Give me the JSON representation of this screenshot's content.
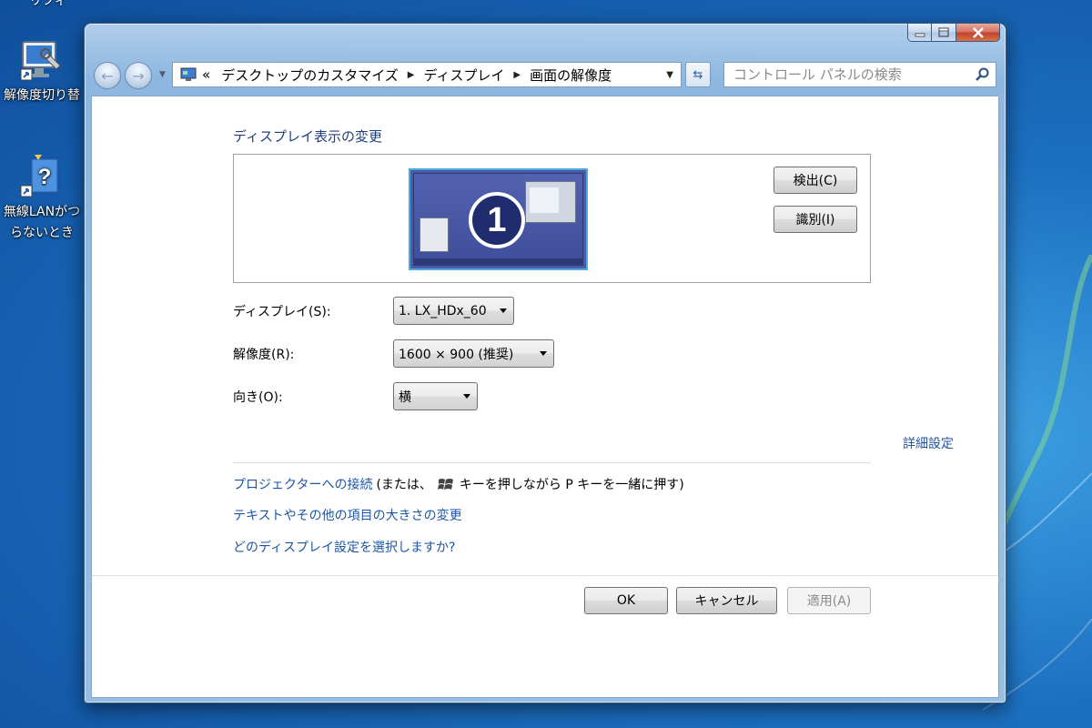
{
  "desktop": {
    "top_cut_label": "リフィ",
    "icons": [
      {
        "label_line1": "解像度切り替",
        "label_line2": ""
      },
      {
        "label_line1": "無線LANがつ",
        "label_line2": "らないとき"
      }
    ]
  },
  "window": {
    "breadcrumb": {
      "prefix": "«",
      "items": [
        "デスクトップのカスタマイズ",
        "ディスプレイ",
        "画面の解像度"
      ]
    },
    "search": {
      "placeholder": "コントロール パネルの検索"
    },
    "section_title": "ディスプレイ表示の変更",
    "monitor": {
      "number": "1"
    },
    "buttons": {
      "detect": "検出(C)",
      "identify": "識別(I)",
      "ok": "OK",
      "cancel": "キャンセル",
      "apply": "適用(A)"
    },
    "fields": {
      "display_label": "ディスプレイ(S):",
      "display_value": "1. LX_HDx_60",
      "resolution_label": "解像度(R):",
      "resolution_value": "1600 × 900 (推奨)",
      "orientation_label": "向き(O):",
      "orientation_value": "横"
    },
    "links": {
      "advanced": "詳細設定",
      "projector": "プロジェクターへの接続",
      "projector_hint_pre": "(または、",
      "projector_hint_post": "キーを押しながら P キーを一緒に押す)",
      "text_size": "テキストやその他の項目の大きさの変更",
      "which_display": "どのディスプレイ設定を選択しますか?"
    }
  },
  "colors": {
    "link": "#1e56a5",
    "title": "#1e3f80",
    "monitor_border": "#4fa6e3"
  }
}
